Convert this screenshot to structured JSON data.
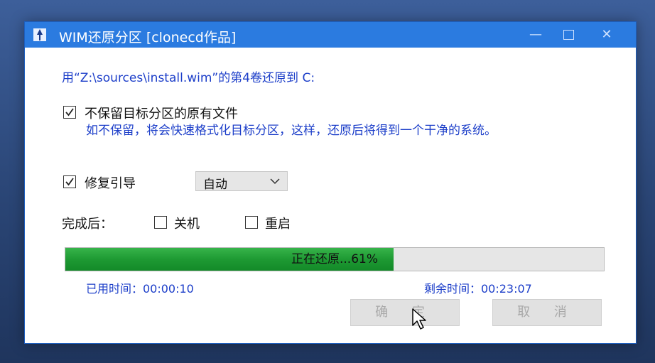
{
  "window": {
    "title": "WIM还原分区  [clonecd作品]",
    "minimize_icon": "minimize-icon",
    "maximize_icon": "maximize-icon",
    "close_icon": "close-icon"
  },
  "restore_line": "用“Z:\\sources\\install.wim”的第4卷还原到 C:",
  "no_keep": {
    "label": "不保留目标分区的原有文件",
    "checked": true,
    "description": "如不保留，将会快速格式化目标分区，这样，还原后将得到一个干净的系统。"
  },
  "repair_boot": {
    "label": "修复引导",
    "checked": true,
    "mode_selected": "自动"
  },
  "after_done": {
    "label": "完成后：",
    "shutdown_label": "关机",
    "shutdown_checked": false,
    "restart_label": "重启",
    "restart_checked": false
  },
  "progress": {
    "text": "正在还原...61%",
    "fraction": 0.61,
    "color": "#1e9a33"
  },
  "elapsed": "已用时间：00:00:10",
  "remaining": "剩余时间：00:23:07",
  "buttons": {
    "ok_label": "确 定",
    "cancel_label": "取 消"
  },
  "colors": {
    "titlebar": "#2b7be0",
    "info_text": "#1c3ec9"
  }
}
